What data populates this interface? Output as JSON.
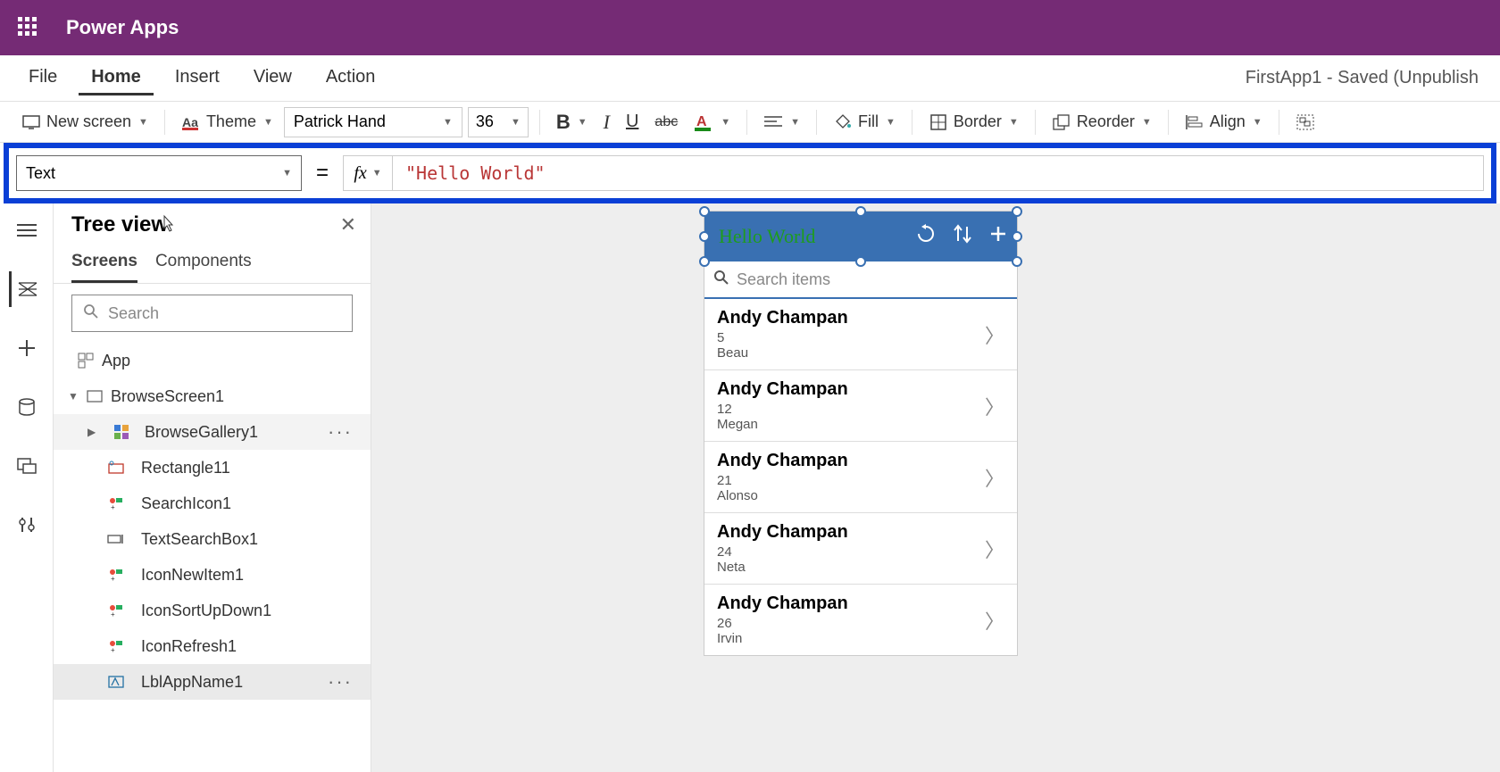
{
  "title_bar": {
    "app_name": "Power Apps"
  },
  "menu": {
    "items": [
      "File",
      "Home",
      "Insert",
      "View",
      "Action"
    ],
    "active": "Home",
    "doc_title": "FirstApp1 - Saved (Unpublish"
  },
  "toolbar": {
    "new_screen": "New screen",
    "theme": "Theme",
    "font_name": "Patrick Hand",
    "font_size": "36",
    "fill": "Fill",
    "border": "Border",
    "reorder": "Reorder",
    "align": "Align"
  },
  "formula": {
    "property": "Text",
    "value": "\"Hello World\""
  },
  "tree": {
    "title": "Tree view",
    "tabs": [
      "Screens",
      "Components"
    ],
    "search_placeholder": "Search",
    "app": "App",
    "screen": "BrowseScreen1",
    "items": [
      {
        "name": "BrowseGallery1",
        "kind": "gallery",
        "more": true,
        "hover": true
      },
      {
        "name": "Rectangle11",
        "kind": "shape"
      },
      {
        "name": "SearchIcon1",
        "kind": "icon"
      },
      {
        "name": "TextSearchBox1",
        "kind": "textbox"
      },
      {
        "name": "IconNewItem1",
        "kind": "icon"
      },
      {
        "name": "IconSortUpDown1",
        "kind": "icon"
      },
      {
        "name": "IconRefresh1",
        "kind": "icon"
      },
      {
        "name": "LblAppName1",
        "kind": "label",
        "selected": true,
        "more": true
      }
    ]
  },
  "canvas": {
    "header_text": "Hello World",
    "search_placeholder": "Search items",
    "gallery": [
      {
        "name": "Andy Champan",
        "num": "5",
        "sub": "Beau"
      },
      {
        "name": "Andy Champan",
        "num": "12",
        "sub": "Megan"
      },
      {
        "name": "Andy Champan",
        "num": "21",
        "sub": "Alonso"
      },
      {
        "name": "Andy Champan",
        "num": "24",
        "sub": "Neta"
      },
      {
        "name": "Andy Champan",
        "num": "26",
        "sub": "Irvin"
      }
    ]
  }
}
